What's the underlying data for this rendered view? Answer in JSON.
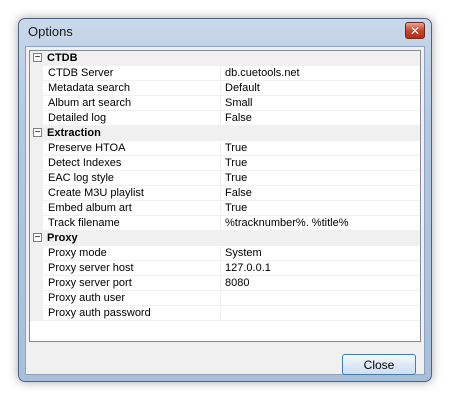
{
  "window": {
    "title": "Options",
    "close_glyph": "✕"
  },
  "grid": {
    "sections": [
      {
        "label": "CTDB",
        "expander": "−",
        "rows": [
          {
            "name": "CTDB Server",
            "value": "db.cuetools.net"
          },
          {
            "name": "Metadata search",
            "value": "Default"
          },
          {
            "name": "Album art search",
            "value": "Small"
          },
          {
            "name": "Detailed log",
            "value": "False"
          }
        ]
      },
      {
        "label": "Extraction",
        "expander": "−",
        "rows": [
          {
            "name": "Preserve HTOA",
            "value": "True"
          },
          {
            "name": "Detect Indexes",
            "value": "True"
          },
          {
            "name": "EAC log style",
            "value": "True"
          },
          {
            "name": "Create M3U playlist",
            "value": "False"
          },
          {
            "name": "Embed album art",
            "value": "True"
          },
          {
            "name": "Track filename",
            "value": "%tracknumber%. %title%"
          }
        ]
      },
      {
        "label": "Proxy",
        "expander": "−",
        "rows": [
          {
            "name": "Proxy mode",
            "value": "System"
          },
          {
            "name": "Proxy server host",
            "value": "127.0.0.1"
          },
          {
            "name": "Proxy server port",
            "value": "8080"
          },
          {
            "name": "Proxy auth user",
            "value": ""
          },
          {
            "name": "Proxy auth password",
            "value": ""
          }
        ]
      }
    ]
  },
  "buttons": {
    "close_label": "Close"
  }
}
